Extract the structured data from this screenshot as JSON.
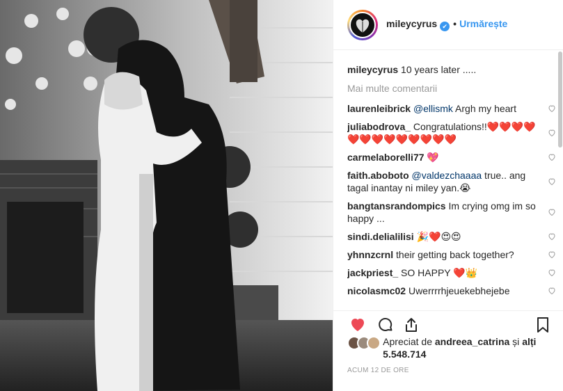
{
  "post": {
    "username": "mileycyrus",
    "verified_mark": "✔",
    "dot": "•",
    "follow_label": "Urmărește",
    "caption_user": "mileycyrus",
    "caption_text": " 10 years later .....",
    "more_comments_label": "Mai multe comentarii"
  },
  "comments": [
    {
      "user": "laurenleibrick",
      "mention": "@ellismk",
      "text": " Argh my heart"
    },
    {
      "user": "juliabodrova_",
      "mention": "",
      "text": " Congratulations!!❤️❤️❤️❤️❤️❤️❤️❤️❤️❤️❤️❤️❤️"
    },
    {
      "user": "carmelaborelli77",
      "mention": "",
      "text": " 💖"
    },
    {
      "user": "faith.aboboto",
      "mention": "@valdezchaaaa",
      "text": " true.. ang tagal inantay ni miley yan.😭"
    },
    {
      "user": "bangtansrandompics",
      "mention": "",
      "text": " Im crying omg im so happy ..."
    },
    {
      "user": "sindi.delialilisi",
      "mention": "",
      "text": " 🎉❤️😍😍"
    },
    {
      "user": "yhnnzcrnl",
      "mention": "",
      "text": " their getting back together?"
    },
    {
      "user": "jackpriest_",
      "mention": "",
      "text": " SO HAPPY ❤️👑"
    },
    {
      "user": "nicolasmc02",
      "mention": "",
      "text": " Uwerrrrhjeuekebhejebe"
    }
  ],
  "likes": {
    "prefix": "Apreciat de ",
    "user": "andreea_catrina",
    "middle": " și ",
    "suffix": "alți 5.548.714"
  },
  "timestamp": "ACUM 12 DE ORE",
  "icons": {
    "like": "heart-filled-icon",
    "comment": "speech-bubble-icon",
    "share": "share-upload-icon",
    "save": "bookmark-icon",
    "comment_like": "heart-outline-icon"
  },
  "colors": {
    "accent_blue": "#3897f0",
    "like_red": "#ed4956",
    "text": "#262626",
    "muted": "#999999"
  }
}
